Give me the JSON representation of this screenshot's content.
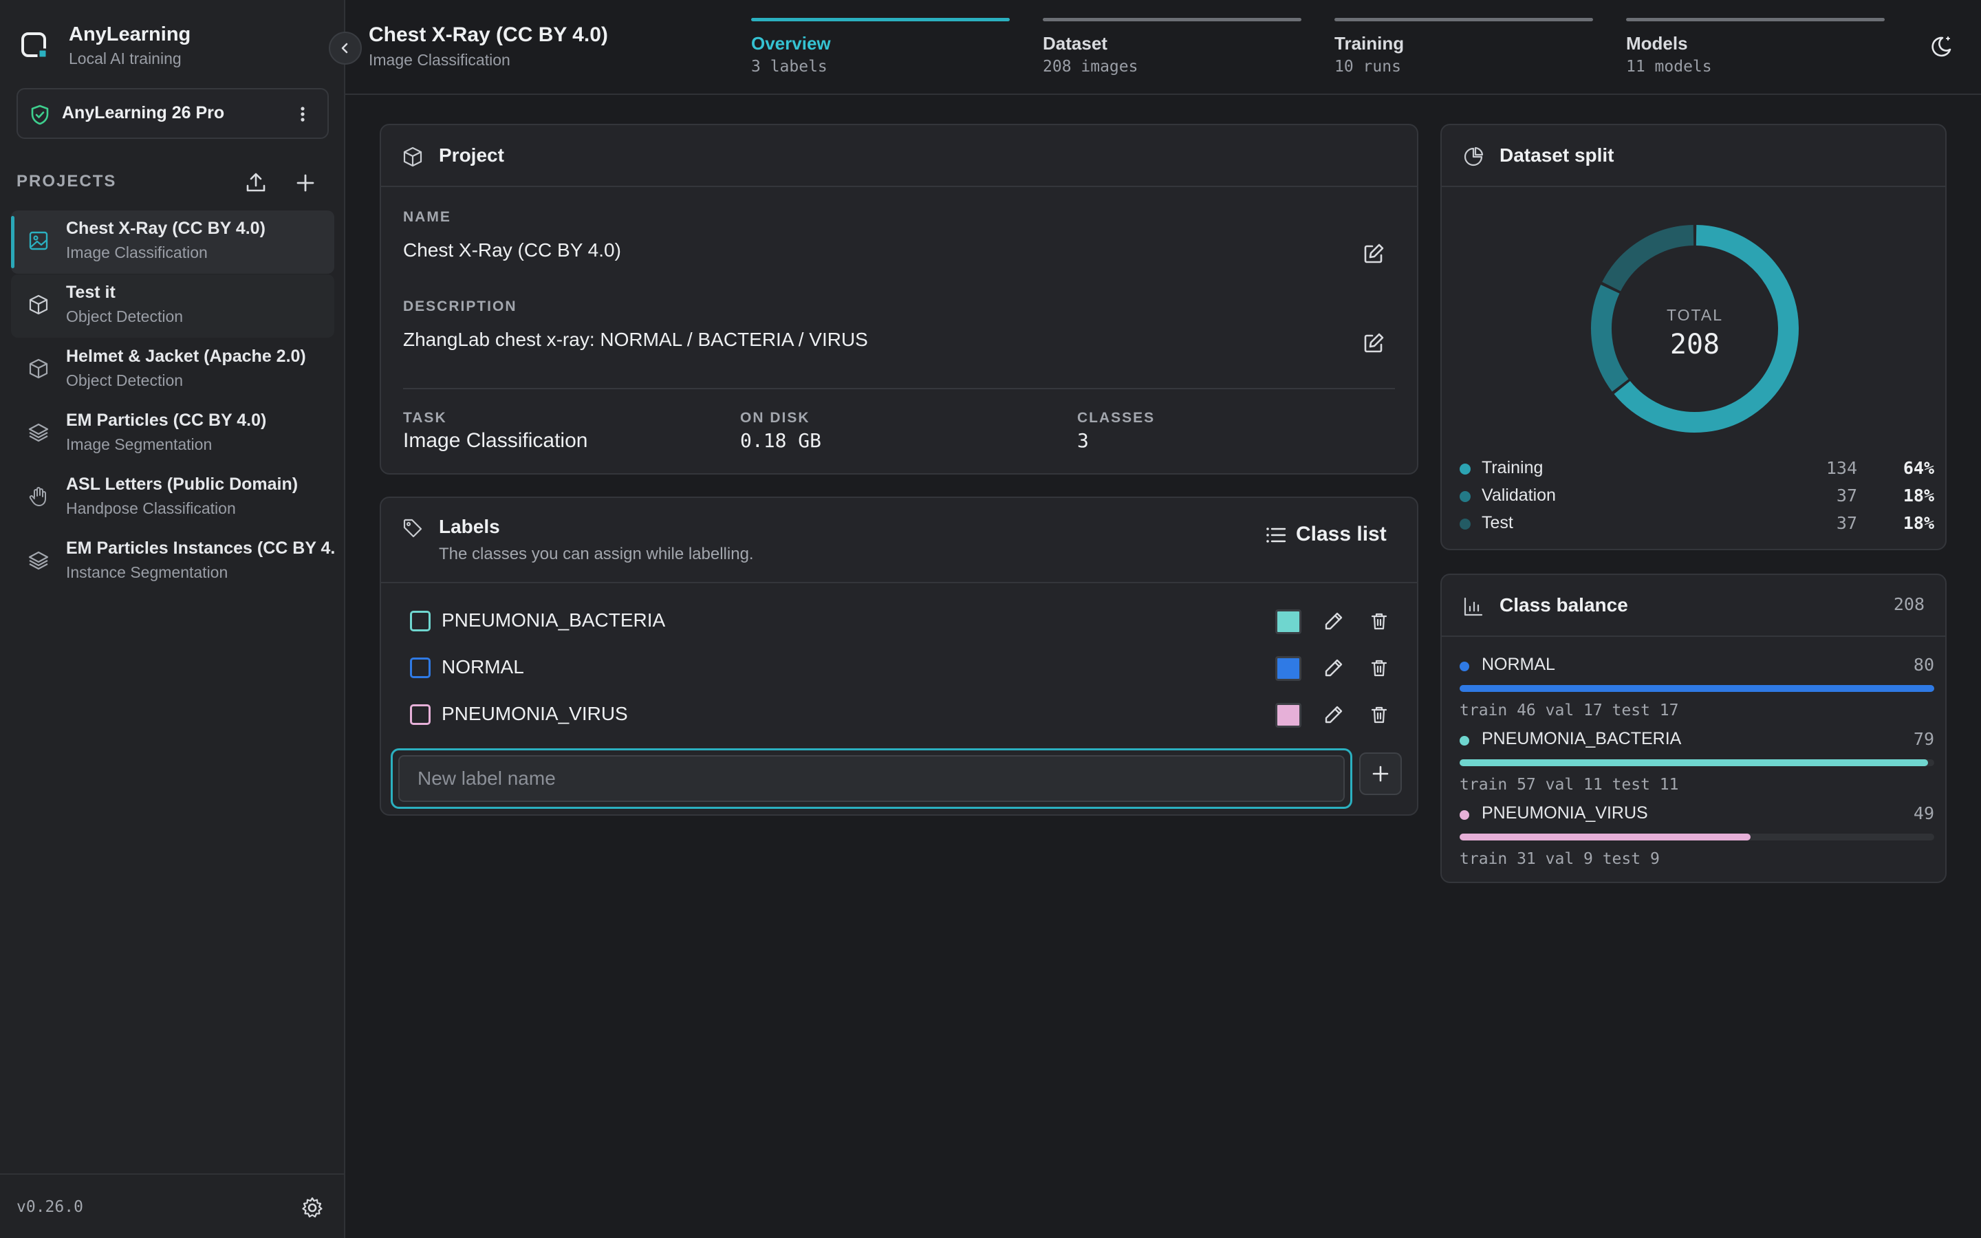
{
  "app": {
    "name": "AnyLearning",
    "subtitle": "Local AI training",
    "plan": "AnyLearning 26 Pro",
    "version": "v0.26.0"
  },
  "sidebar": {
    "projects_heading": "PROJECTS",
    "projects": [
      {
        "name": "Chest X-Ray (CC BY 4.0)",
        "type": "Image Classification",
        "icon": "image-icon",
        "active": true
      },
      {
        "name": "Test it",
        "type": "Object Detection",
        "icon": "cube-icon"
      },
      {
        "name": "Helmet & Jacket (Apache 2.0)",
        "type": "Object Detection",
        "icon": "cube-icon"
      },
      {
        "name": "EM Particles (CC BY 4.0)",
        "type": "Image Segmentation",
        "icon": "layers-icon"
      },
      {
        "name": "ASL Letters (Public Domain)",
        "type": "Handpose Classification",
        "icon": "hand-icon"
      },
      {
        "name": "EM Particles Instances (CC BY 4.0)",
        "type": "Instance Segmentation",
        "icon": "layers-icon"
      }
    ]
  },
  "header": {
    "title": "Chest X-Ray (CC BY 4.0)",
    "subtitle": "Image Classification",
    "tabs": [
      {
        "label": "Overview",
        "sub": "3 labels",
        "active": true
      },
      {
        "label": "Dataset",
        "sub": "208 images"
      },
      {
        "label": "Training",
        "sub": "10 runs"
      },
      {
        "label": "Models",
        "sub": "11 models"
      }
    ]
  },
  "project": {
    "title": "Project",
    "name_label": "NAME",
    "name": "Chest X-Ray (CC BY 4.0)",
    "description_label": "DESCRIPTION",
    "description": "ZhangLab chest x-ray: NORMAL / BACTERIA / VIRUS",
    "task_label": "TASK",
    "task": "Image Classification",
    "disk_label": "ON DISK",
    "disk": "0.18 GB",
    "classes_label": "CLASSES",
    "classes": "3"
  },
  "labels": {
    "title": "Labels",
    "subtitle": "The classes you can assign while labelling.",
    "class_list_button": "Class list",
    "items": [
      {
        "name": "PNEUMONIA_BACTERIA",
        "color": "#6fd6cf"
      },
      {
        "name": "NORMAL",
        "color": "#2f7ae5"
      },
      {
        "name": "PNEUMONIA_VIRUS",
        "color": "#e6b0d8"
      }
    ],
    "new_placeholder": "New label name"
  },
  "split": {
    "title": "Dataset split",
    "total_label": "TOTAL",
    "total": "208",
    "rows": [
      {
        "name": "Training",
        "count": "134",
        "pct": "64%",
        "value": 134,
        "color": "#2ca3b2"
      },
      {
        "name": "Validation",
        "count": "37",
        "pct": "18%",
        "value": 37,
        "color": "#237a87"
      },
      {
        "name": "Test",
        "count": "37",
        "pct": "18%",
        "value": 37,
        "color": "#235b64"
      }
    ]
  },
  "balance": {
    "title": "Class balance",
    "total": "208",
    "max": 80,
    "items": [
      {
        "name": "NORMAL",
        "count": "80",
        "value": 80,
        "color": "#2f7ae5",
        "splits": "train 46  val 17  test 17"
      },
      {
        "name": "PNEUMONIA_BACTERIA",
        "count": "79",
        "value": 79,
        "color": "#6fd6cf",
        "splits": "train 57  val 11  test 11"
      },
      {
        "name": "PNEUMONIA_VIRUS",
        "count": "49",
        "value": 49,
        "color": "#e6b0d8",
        "splits": "train 31  val 9  test 9"
      }
    ]
  },
  "colors": {
    "accent": "#2bb0c0",
    "background": "#1b1c1f",
    "panel": "#242529"
  }
}
